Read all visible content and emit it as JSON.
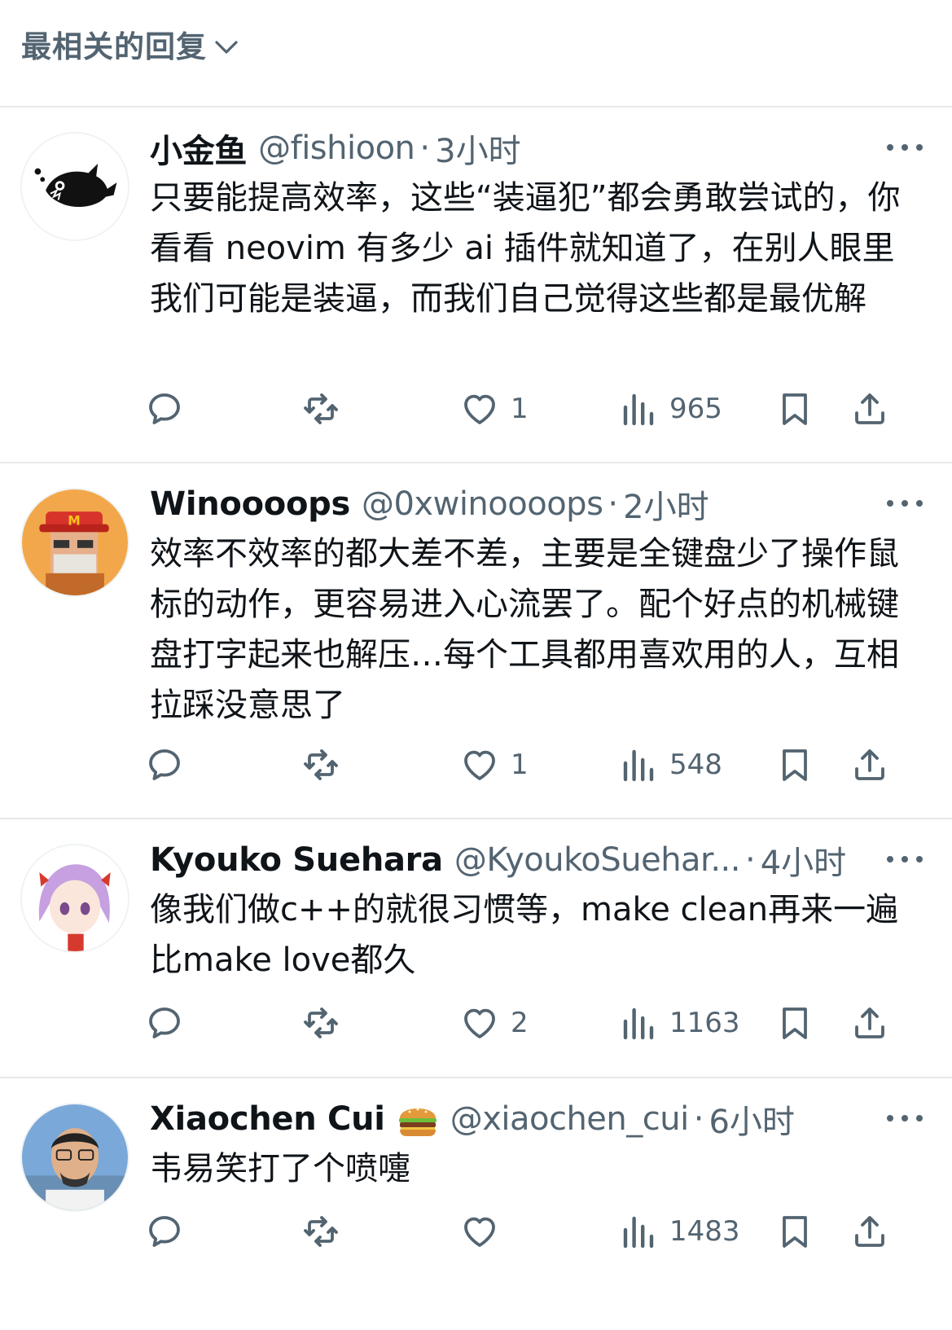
{
  "sort": {
    "label": "最相关的回复"
  },
  "replies": [
    {
      "name": "小金鱼",
      "handle": "@fishioon",
      "dot": "·",
      "time": "3小时",
      "text": "只要能提高效率，这些“装逼犯”都会勇敢尝试的，你看看 neovim 有多少 ai 插件就知道了，在别人眼里我们可能是装逼，而我们自己觉得这些都是最优解",
      "likes": "1",
      "views": "965"
    },
    {
      "name": "Winoooops",
      "handle": "@0xwinoooops",
      "dot": "·",
      "time": "2小时",
      "text": "效率不效率的都大差不差，主要是全键盘少了操作鼠标的动作，更容易进入心流罢了。配个好点的机械键盘打字起来也解压…每个工具都用喜欢用的人，互相拉踩没意思了",
      "likes": "1",
      "views": "548"
    },
    {
      "name": "Kyouko Suehara",
      "handle": "@KyoukoSuehar...",
      "dot": "·",
      "time": "4小时",
      "text": "像我们做c++的就很习惯等，make clean再来一遍比make love都久",
      "likes": "2",
      "views": "1163"
    },
    {
      "name": "Xiaochen Cui",
      "handle": "@xiaochen_cui",
      "dot": "·",
      "time": "6小时",
      "text": "韦易笑打了个喷嚏",
      "likes": "",
      "views": "1483"
    }
  ],
  "colors": {
    "text": "#0f1419",
    "secondary": "#536471",
    "divider": "#e7e9ea"
  },
  "icons": [
    "chevron-down-icon",
    "more-icon",
    "reply-icon",
    "retweet-icon",
    "like-icon",
    "views-icon",
    "bookmark-icon",
    "share-icon",
    "burger-emoji"
  ]
}
